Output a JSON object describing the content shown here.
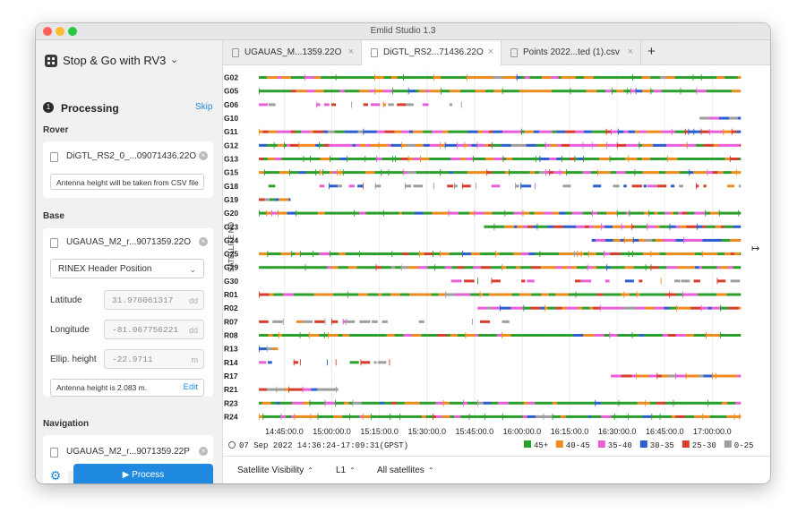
{
  "app": {
    "title": "Emlid Studio 1.3"
  },
  "colors": {
    "close": "#fe5f57",
    "minimize": "#febc2e",
    "zoom": "#28c840",
    "accent": "#1f8ae0"
  },
  "sidebar": {
    "project_title": "Stop & Go with RV3",
    "step_number": "1",
    "step_title": "Processing",
    "skip_label": "Skip",
    "rover": {
      "section_label": "Rover",
      "file_name": "DiGTL_RS2_0_...09071436.22O",
      "note": "Antenna height will be taken from CSV file"
    },
    "base": {
      "section_label": "Base",
      "file_name": "UGAUAS_M2_r...9071359.22O",
      "position_mode": "RINEX Header Position",
      "latitude_label": "Latitude",
      "latitude_value": "31.970061317",
      "latitude_unit": "dd",
      "longitude_label": "Longitude",
      "longitude_value": "-81.067756221",
      "longitude_unit": "dd",
      "height_label": "Ellip. height",
      "height_value": "-22.9711",
      "height_unit": "m",
      "antenna_text": "Antenna height is 2.083 m.",
      "edit_label": "Edit"
    },
    "navigation": {
      "section_label": "Navigation",
      "file_name": "UGAUAS_M2_r...9071359.22P"
    },
    "process_label": "Process"
  },
  "tabs": [
    {
      "label": "UGAUAS_M...1359.22O",
      "active": false
    },
    {
      "label": "DiGTL_RS2...71436.22O",
      "active": true
    },
    {
      "label": "Points 2022...ted (1).csv",
      "active": false
    }
  ],
  "bottom_bar": {
    "view_label": "Satellite Visibility",
    "band_label": "L1",
    "filter_label": "All satellites"
  },
  "chart_data": {
    "type": "scatter",
    "title": "",
    "ylabel": "SATELLITE NO",
    "xlabel": "",
    "x_ticks": [
      "14:45:00.0",
      "15:00:00.0",
      "15:15:00.0",
      "15:30:00.0",
      "15:45:00.0",
      "16:00:00.0",
      "16:15:00.0",
      "16:30:00.0",
      "16:45:00.0",
      "17:00:00.0"
    ],
    "x_range": [
      "14:36:24",
      "17:09:31"
    ],
    "time_text": "07 Sep 2022 14:36:24-17:09:31(GPST)",
    "legend": [
      {
        "label": "45+",
        "color": "#2ca02c"
      },
      {
        "label": "40-45",
        "color": "#f08c1e"
      },
      {
        "label": "35-40",
        "color": "#e85fd8"
      },
      {
        "label": "30-35",
        "color": "#2a5fcf"
      },
      {
        "label": "25-30",
        "color": "#d63d2b"
      },
      {
        "label": "0-25",
        "color": "#9e9e9e"
      }
    ],
    "satellites": [
      {
        "id": "G02",
        "segments": [
          [
            "14:37",
            "17:09",
            "mix-high"
          ]
        ]
      },
      {
        "id": "G05",
        "segments": [
          [
            "14:37",
            "17:09",
            "mix-high"
          ]
        ]
      },
      {
        "id": "G06",
        "segments": [
          [
            "14:37",
            "15:44",
            "mix-low"
          ]
        ]
      },
      {
        "id": "G10",
        "segments": [
          [
            "16:56",
            "17:09",
            "mix-low"
          ]
        ]
      },
      {
        "id": "G11",
        "segments": [
          [
            "14:37",
            "17:09",
            "mix-mid"
          ]
        ]
      },
      {
        "id": "G12",
        "segments": [
          [
            "14:37",
            "17:09",
            "mix-mid"
          ]
        ]
      },
      {
        "id": "G13",
        "segments": [
          [
            "14:37",
            "17:09",
            "mix-high"
          ]
        ]
      },
      {
        "id": "G15",
        "segments": [
          [
            "14:37",
            "17:09",
            "mix-high"
          ]
        ]
      },
      {
        "id": "G18",
        "segments": [
          [
            "14:40",
            "17:09",
            "mix-low"
          ]
        ]
      },
      {
        "id": "G19",
        "segments": [
          [
            "14:37",
            "14:47",
            "mix-low"
          ]
        ]
      },
      {
        "id": "G20",
        "segments": [
          [
            "14:37",
            "17:09",
            "mix-high"
          ]
        ]
      },
      {
        "id": "G23",
        "segments": [
          [
            "15:48",
            "17:09",
            "mix-mid"
          ]
        ]
      },
      {
        "id": "G24",
        "segments": [
          [
            "16:22",
            "17:09",
            "mix-mid"
          ]
        ]
      },
      {
        "id": "G25",
        "segments": [
          [
            "14:37",
            "17:09",
            "mix-high"
          ]
        ]
      },
      {
        "id": "G29",
        "segments": [
          [
            "14:37",
            "17:09",
            "mix-high"
          ]
        ]
      },
      {
        "id": "G30",
        "segments": [
          [
            "15:35",
            "17:09",
            "mix-low"
          ]
        ]
      },
      {
        "id": "R01",
        "segments": [
          [
            "14:37",
            "17:09",
            "mix-high"
          ]
        ]
      },
      {
        "id": "R02",
        "segments": [
          [
            "15:46",
            "17:09",
            "mix-mid"
          ]
        ]
      },
      {
        "id": "R07",
        "segments": [
          [
            "14:37",
            "15:56",
            "mix-low"
          ]
        ]
      },
      {
        "id": "R08",
        "segments": [
          [
            "14:37",
            "17:09",
            "mix-high"
          ]
        ]
      },
      {
        "id": "R13",
        "segments": [
          [
            "14:37",
            "14:43",
            "mix-low"
          ]
        ]
      },
      {
        "id": "R14",
        "segments": [
          [
            "14:37",
            "15:22",
            "mix-low"
          ]
        ]
      },
      {
        "id": "R17",
        "segments": [
          [
            "16:28",
            "17:09",
            "mix-mid"
          ]
        ]
      },
      {
        "id": "R21",
        "segments": [
          [
            "14:37",
            "15:02",
            "mix-low"
          ]
        ]
      },
      {
        "id": "R23",
        "segments": [
          [
            "14:37",
            "17:09",
            "mix-high"
          ]
        ]
      },
      {
        "id": "R24",
        "segments": [
          [
            "14:37",
            "17:09",
            "mix-high"
          ]
        ]
      }
    ]
  }
}
